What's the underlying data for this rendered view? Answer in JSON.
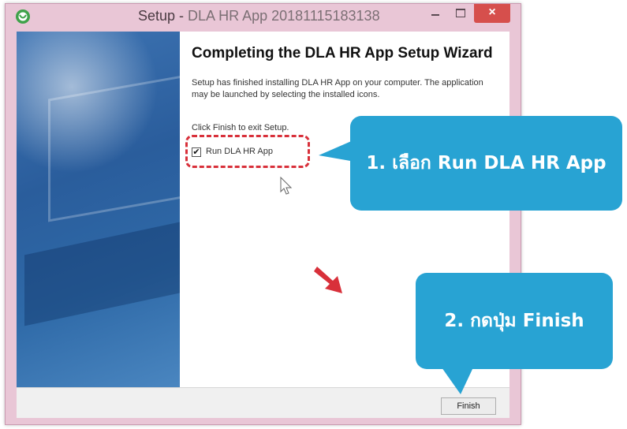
{
  "window": {
    "title_main": "Setup - ",
    "title_app": "DLA HR App 20181115183138",
    "close_glyph": "×",
    "icons": [
      "app-icon",
      "minimize-icon",
      "maximize-icon",
      "close-icon"
    ]
  },
  "wizard": {
    "heading": "Completing the DLA HR App Setup Wizard",
    "description": "Setup has finished installing DLA HR App on your computer. The application may be launched by selecting the installed icons.",
    "click_finish_text": "Click Finish to exit Setup.",
    "run_checkbox": {
      "label": "Run DLA HR App",
      "checked": true,
      "check_glyph": "✔"
    }
  },
  "footer": {
    "finish_label": "Finish"
  },
  "annotations": {
    "callout1": "1. เลือก Run DLA HR App",
    "callout2": "2. กดปุ่ม Finish",
    "colors": {
      "callout": "#28a3d3",
      "highlight": "#d8303a",
      "title_bar": "#e9c6d6"
    }
  }
}
